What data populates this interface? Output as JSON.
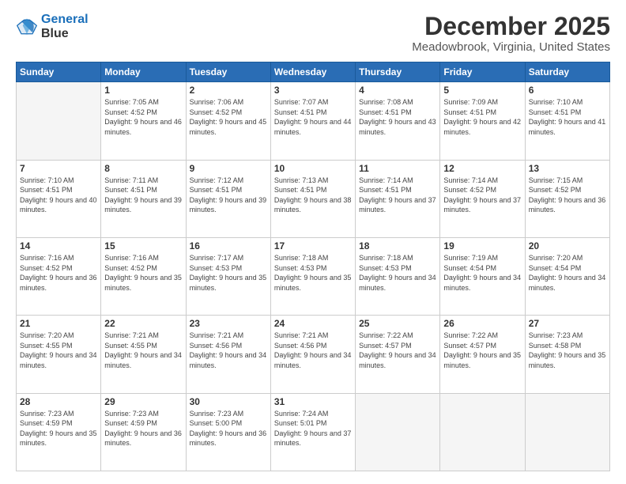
{
  "logo": {
    "line1": "General",
    "line2": "Blue"
  },
  "title": "December 2025",
  "location": "Meadowbrook, Virginia, United States",
  "days_header": [
    "Sunday",
    "Monday",
    "Tuesday",
    "Wednesday",
    "Thursday",
    "Friday",
    "Saturday"
  ],
  "weeks": [
    [
      {
        "day": "",
        "sunrise": "",
        "sunset": "",
        "daylight": "",
        "empty": true
      },
      {
        "day": "1",
        "sunrise": "Sunrise: 7:05 AM",
        "sunset": "Sunset: 4:52 PM",
        "daylight": "Daylight: 9 hours and 46 minutes.",
        "empty": false
      },
      {
        "day": "2",
        "sunrise": "Sunrise: 7:06 AM",
        "sunset": "Sunset: 4:52 PM",
        "daylight": "Daylight: 9 hours and 45 minutes.",
        "empty": false
      },
      {
        "day": "3",
        "sunrise": "Sunrise: 7:07 AM",
        "sunset": "Sunset: 4:51 PM",
        "daylight": "Daylight: 9 hours and 44 minutes.",
        "empty": false
      },
      {
        "day": "4",
        "sunrise": "Sunrise: 7:08 AM",
        "sunset": "Sunset: 4:51 PM",
        "daylight": "Daylight: 9 hours and 43 minutes.",
        "empty": false
      },
      {
        "day": "5",
        "sunrise": "Sunrise: 7:09 AM",
        "sunset": "Sunset: 4:51 PM",
        "daylight": "Daylight: 9 hours and 42 minutes.",
        "empty": false
      },
      {
        "day": "6",
        "sunrise": "Sunrise: 7:10 AM",
        "sunset": "Sunset: 4:51 PM",
        "daylight": "Daylight: 9 hours and 41 minutes.",
        "empty": false
      }
    ],
    [
      {
        "day": "7",
        "sunrise": "Sunrise: 7:10 AM",
        "sunset": "Sunset: 4:51 PM",
        "daylight": "Daylight: 9 hours and 40 minutes.",
        "empty": false
      },
      {
        "day": "8",
        "sunrise": "Sunrise: 7:11 AM",
        "sunset": "Sunset: 4:51 PM",
        "daylight": "Daylight: 9 hours and 39 minutes.",
        "empty": false
      },
      {
        "day": "9",
        "sunrise": "Sunrise: 7:12 AM",
        "sunset": "Sunset: 4:51 PM",
        "daylight": "Daylight: 9 hours and 39 minutes.",
        "empty": false
      },
      {
        "day": "10",
        "sunrise": "Sunrise: 7:13 AM",
        "sunset": "Sunset: 4:51 PM",
        "daylight": "Daylight: 9 hours and 38 minutes.",
        "empty": false
      },
      {
        "day": "11",
        "sunrise": "Sunrise: 7:14 AM",
        "sunset": "Sunset: 4:51 PM",
        "daylight": "Daylight: 9 hours and 37 minutes.",
        "empty": false
      },
      {
        "day": "12",
        "sunrise": "Sunrise: 7:14 AM",
        "sunset": "Sunset: 4:52 PM",
        "daylight": "Daylight: 9 hours and 37 minutes.",
        "empty": false
      },
      {
        "day": "13",
        "sunrise": "Sunrise: 7:15 AM",
        "sunset": "Sunset: 4:52 PM",
        "daylight": "Daylight: 9 hours and 36 minutes.",
        "empty": false
      }
    ],
    [
      {
        "day": "14",
        "sunrise": "Sunrise: 7:16 AM",
        "sunset": "Sunset: 4:52 PM",
        "daylight": "Daylight: 9 hours and 36 minutes.",
        "empty": false
      },
      {
        "day": "15",
        "sunrise": "Sunrise: 7:16 AM",
        "sunset": "Sunset: 4:52 PM",
        "daylight": "Daylight: 9 hours and 35 minutes.",
        "empty": false
      },
      {
        "day": "16",
        "sunrise": "Sunrise: 7:17 AM",
        "sunset": "Sunset: 4:53 PM",
        "daylight": "Daylight: 9 hours and 35 minutes.",
        "empty": false
      },
      {
        "day": "17",
        "sunrise": "Sunrise: 7:18 AM",
        "sunset": "Sunset: 4:53 PM",
        "daylight": "Daylight: 9 hours and 35 minutes.",
        "empty": false
      },
      {
        "day": "18",
        "sunrise": "Sunrise: 7:18 AM",
        "sunset": "Sunset: 4:53 PM",
        "daylight": "Daylight: 9 hours and 34 minutes.",
        "empty": false
      },
      {
        "day": "19",
        "sunrise": "Sunrise: 7:19 AM",
        "sunset": "Sunset: 4:54 PM",
        "daylight": "Daylight: 9 hours and 34 minutes.",
        "empty": false
      },
      {
        "day": "20",
        "sunrise": "Sunrise: 7:20 AM",
        "sunset": "Sunset: 4:54 PM",
        "daylight": "Daylight: 9 hours and 34 minutes.",
        "empty": false
      }
    ],
    [
      {
        "day": "21",
        "sunrise": "Sunrise: 7:20 AM",
        "sunset": "Sunset: 4:55 PM",
        "daylight": "Daylight: 9 hours and 34 minutes.",
        "empty": false
      },
      {
        "day": "22",
        "sunrise": "Sunrise: 7:21 AM",
        "sunset": "Sunset: 4:55 PM",
        "daylight": "Daylight: 9 hours and 34 minutes.",
        "empty": false
      },
      {
        "day": "23",
        "sunrise": "Sunrise: 7:21 AM",
        "sunset": "Sunset: 4:56 PM",
        "daylight": "Daylight: 9 hours and 34 minutes.",
        "empty": false
      },
      {
        "day": "24",
        "sunrise": "Sunrise: 7:21 AM",
        "sunset": "Sunset: 4:56 PM",
        "daylight": "Daylight: 9 hours and 34 minutes.",
        "empty": false
      },
      {
        "day": "25",
        "sunrise": "Sunrise: 7:22 AM",
        "sunset": "Sunset: 4:57 PM",
        "daylight": "Daylight: 9 hours and 34 minutes.",
        "empty": false
      },
      {
        "day": "26",
        "sunrise": "Sunrise: 7:22 AM",
        "sunset": "Sunset: 4:57 PM",
        "daylight": "Daylight: 9 hours and 35 minutes.",
        "empty": false
      },
      {
        "day": "27",
        "sunrise": "Sunrise: 7:23 AM",
        "sunset": "Sunset: 4:58 PM",
        "daylight": "Daylight: 9 hours and 35 minutes.",
        "empty": false
      }
    ],
    [
      {
        "day": "28",
        "sunrise": "Sunrise: 7:23 AM",
        "sunset": "Sunset: 4:59 PM",
        "daylight": "Daylight: 9 hours and 35 minutes.",
        "empty": false
      },
      {
        "day": "29",
        "sunrise": "Sunrise: 7:23 AM",
        "sunset": "Sunset: 4:59 PM",
        "daylight": "Daylight: 9 hours and 36 minutes.",
        "empty": false
      },
      {
        "day": "30",
        "sunrise": "Sunrise: 7:23 AM",
        "sunset": "Sunset: 5:00 PM",
        "daylight": "Daylight: 9 hours and 36 minutes.",
        "empty": false
      },
      {
        "day": "31",
        "sunrise": "Sunrise: 7:24 AM",
        "sunset": "Sunset: 5:01 PM",
        "daylight": "Daylight: 9 hours and 37 minutes.",
        "empty": false
      },
      {
        "day": "",
        "sunrise": "",
        "sunset": "",
        "daylight": "",
        "empty": true
      },
      {
        "day": "",
        "sunrise": "",
        "sunset": "",
        "daylight": "",
        "empty": true
      },
      {
        "day": "",
        "sunrise": "",
        "sunset": "",
        "daylight": "",
        "empty": true
      }
    ]
  ]
}
